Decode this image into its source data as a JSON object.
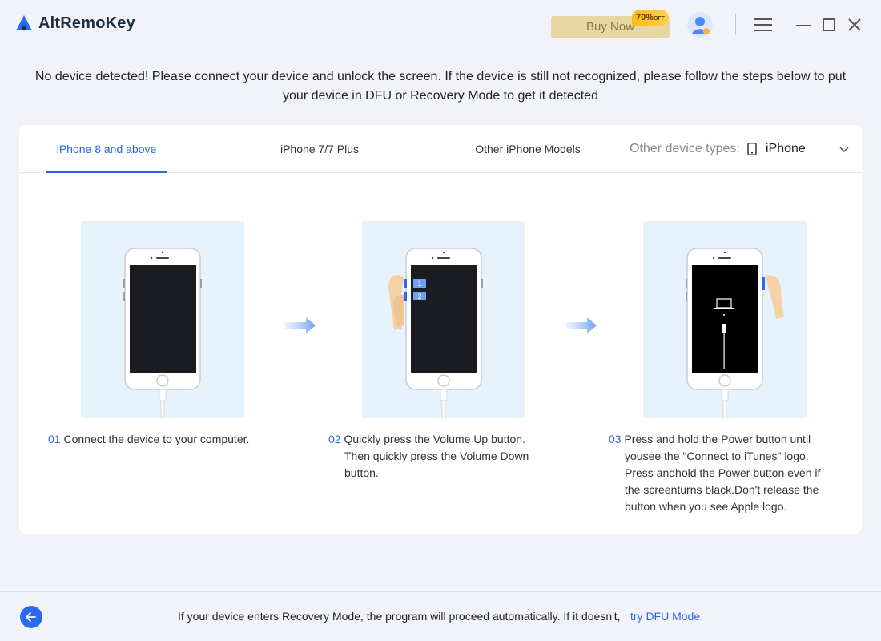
{
  "app": {
    "name": "AltRemoKey",
    "buy_now": "Buy Now",
    "discount_value": "70%",
    "discount_suffix": "OFF"
  },
  "notice": "No device detected! Please connect your device and unlock the screen. If the device is still not recognized, please follow the steps below to put your device in DFU or Recovery Mode to get it detected",
  "tabs": [
    {
      "label": "iPhone 8 and above",
      "active": true
    },
    {
      "label": "iPhone 7/7 Plus",
      "active": false
    },
    {
      "label": "Other iPhone Models",
      "active": false
    }
  ],
  "device_type": {
    "label": "Other device types:",
    "selected": "iPhone",
    "icon": "phone-icon"
  },
  "steps": [
    {
      "num": "01",
      "text": "Connect the device to your computer.",
      "markers": []
    },
    {
      "num": "02",
      "text": "Quickly press the Volume Up button. Then quickly press the Volume Down button.",
      "markers": [
        "1",
        "2"
      ]
    },
    {
      "num": "03",
      "text": "Press and hold the Power button until yousee the \"Connect to iTunes\" logo. Press andhold the Power button even if the screenturns black.Don't release the button when you see Apple logo.",
      "markers": []
    }
  ],
  "footer": {
    "text": "If your device enters Recovery Mode, the program will proceed automatically. If it doesn't,",
    "link": "try DFU Mode."
  },
  "colors": {
    "accent": "#2a66e3",
    "background": "#f1f3f9",
    "buy_now_bg": "#e9d7a3",
    "illustration_bg": "#e6f3fc"
  }
}
